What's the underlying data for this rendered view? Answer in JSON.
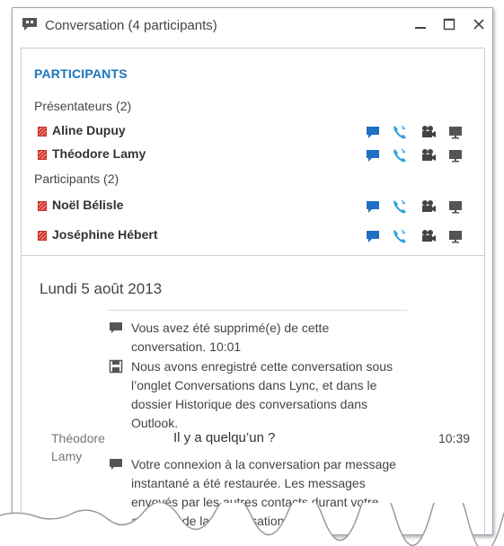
{
  "window": {
    "title": "Conversation (4 participants)"
  },
  "roster": {
    "heading": "PARTICIPANTS",
    "groups": [
      {
        "label": "Présentateurs (2)",
        "people": [
          {
            "name": "Aline Dupuy",
            "presence": "busy"
          },
          {
            "name": "Théodore Lamy",
            "presence": "busy"
          }
        ]
      },
      {
        "label": "Participants (2)",
        "people": [
          {
            "name": "Noël Bélisle",
            "presence": "busy"
          },
          {
            "name": "Joséphine Hébert",
            "presence": "busy"
          }
        ]
      }
    ],
    "actions": [
      "im-icon",
      "phone-icon",
      "video-icon",
      "screen-share-icon"
    ]
  },
  "chat": {
    "date": "Lundi 5 août 2013",
    "messages": [
      {
        "type": "system",
        "icon": "chat-bubble-icon",
        "text": "Vous avez été supprimé(e) de cette conversation. 10:01"
      },
      {
        "type": "system",
        "icon": "save-icon",
        "text": "Nous avons enregistré cette conversation sous l’onglet Conversations dans Lync, et dans le dossier Historique des conversations dans Outlook."
      },
      {
        "type": "message",
        "sender": "Théodore Lamy",
        "text": "Il y a quelqu’un ?",
        "time": "10:39"
      },
      {
        "type": "system",
        "icon": "chat-bubble-icon",
        "text": "Votre connexion à la conversation par message instantané a été restaurée. Les messages envoyés par les autres contacts durant votre absence de la conversation"
      }
    ]
  },
  "colors": {
    "accent": "#1b75bb",
    "im_icon": "#1f6fc3",
    "phone_icon": "#2aa3d8",
    "presence_busy": "#d9362f"
  }
}
